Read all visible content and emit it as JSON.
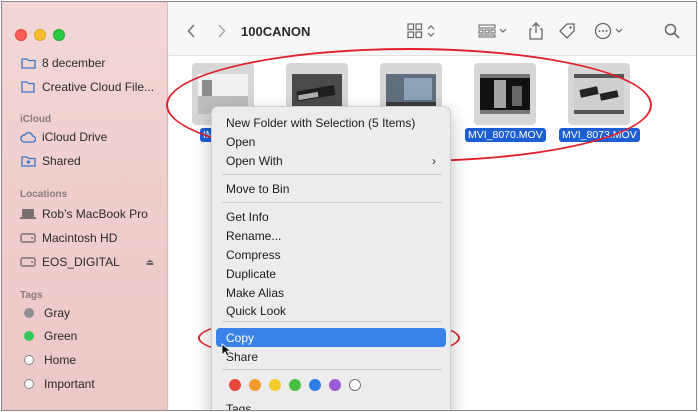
{
  "window": {
    "path_title": "100CANON"
  },
  "colors": {
    "accent": "#1d5fd3",
    "highlight": "#3b82e8",
    "annotation": "#e0202a"
  },
  "sidebar": {
    "favorites": [
      {
        "label": "8 december",
        "icon": "folder-icon"
      },
      {
        "label": "Creative Cloud File...",
        "icon": "document-icon"
      }
    ],
    "icloud_header": "iCloud",
    "icloud": [
      {
        "label": "iCloud Drive",
        "icon": "cloud-icon"
      },
      {
        "label": "Shared",
        "icon": "shared-folder-icon"
      }
    ],
    "locations_header": "Locations",
    "locations": [
      {
        "label": "Rob’s MacBook Pro",
        "icon": "laptop-icon"
      },
      {
        "label": "Macintosh HD",
        "icon": "disk-icon"
      },
      {
        "label": "EOS_DIGITAL",
        "icon": "disk-icon"
      }
    ],
    "tags_header": "Tags",
    "tags": [
      {
        "label": "Gray",
        "color": "#8e8e93"
      },
      {
        "label": "Green",
        "color": "#34c759"
      },
      {
        "label": "Home",
        "color": "#ffffff"
      },
      {
        "label": "Important",
        "color": "#ffffff"
      }
    ]
  },
  "files": [
    {
      "name": "IMG_8...",
      "thumb": "photo"
    },
    {
      "name": "",
      "thumb": "photo"
    },
    {
      "name": "",
      "thumb": "photo"
    },
    {
      "name": "MVI_8070.MOV",
      "thumb": "video"
    },
    {
      "name": "MVI_8073.MOV",
      "thumb": "video"
    }
  ],
  "context_menu": {
    "new_folder": "New Folder with Selection (5 Items)",
    "open": "Open",
    "open_with": "Open With",
    "move_to_bin": "Move to Bin",
    "get_info": "Get Info",
    "rename": "Rename...",
    "compress": "Compress",
    "duplicate": "Duplicate",
    "make_alias": "Make Alias",
    "quick_look": "Quick Look",
    "copy": "Copy",
    "share": "Share",
    "tags": "Tags...",
    "tag_colors": [
      "#e8463b",
      "#f39a2c",
      "#f3cb2c",
      "#47c043",
      "#2e7ee8",
      "#9c5bd0",
      "#ffffff"
    ]
  }
}
